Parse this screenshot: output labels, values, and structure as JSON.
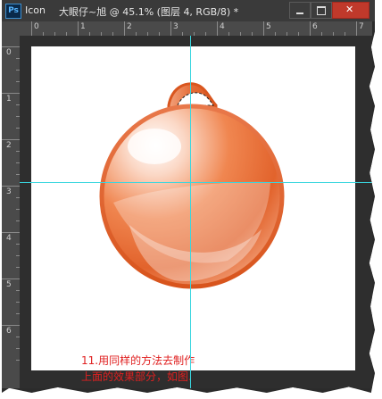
{
  "window": {
    "app_icon": "Ps",
    "app_name": "Icon",
    "doc_title": "大眼仔~旭 @ 45.1% (图层 4, RGB/8) *",
    "minimize_icon": "minimize-icon",
    "maximize_icon": "maximize-icon",
    "close_icon": "close-icon"
  },
  "ruler": {
    "h_labels": [
      "0",
      "1",
      "2",
      "3",
      "4",
      "5",
      "6",
      "7"
    ],
    "v_labels": [
      "0",
      "1",
      "2",
      "3",
      "4",
      "5",
      "6"
    ]
  },
  "canvas": {
    "guide_color": "#39d6df",
    "ornament_color": "#e0622c"
  },
  "caption": {
    "line1": "11.用同样的方法去制作",
    "line2": "上面的效果部分，如图."
  }
}
